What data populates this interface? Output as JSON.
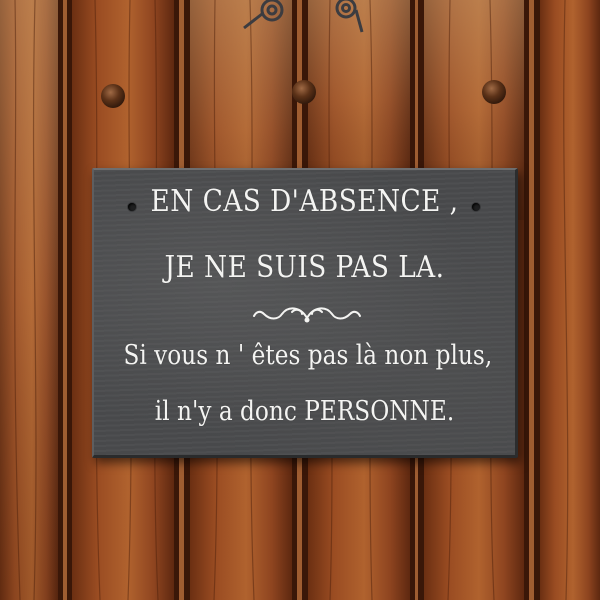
{
  "sign": {
    "line1": "EN CAS D'ABSENCE ,",
    "line2": "JE NE SUIS PAS LA.",
    "line3": "Si vous n ' êtes pas là non plus,",
    "line4": "il n'y a donc  PERSONNE."
  },
  "colors": {
    "wood": "#7a3a18",
    "slate": "#4a4b4d",
    "lettering": "#f4f4f2"
  }
}
